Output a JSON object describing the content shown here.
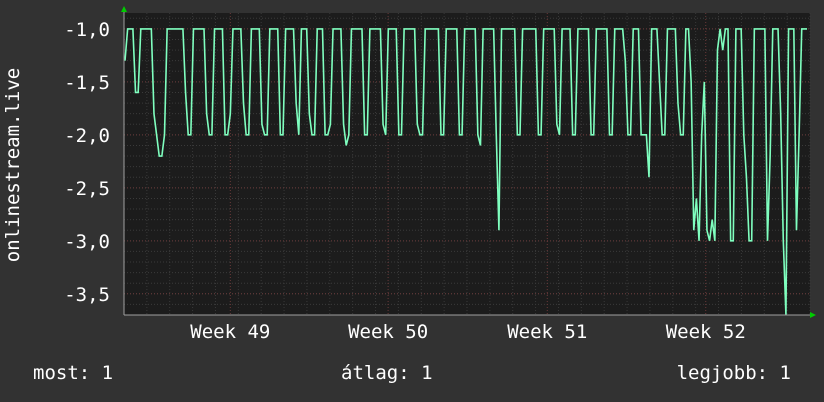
{
  "chart_data": {
    "type": "line",
    "ylabel": "onlinestream.live",
    "ylim": [
      -3.7,
      -0.85
    ],
    "yticks": [
      "-1,0",
      "-1,5",
      "-2,0",
      "-2,5",
      "-3,0",
      "-3,5"
    ],
    "ytick_values": [
      -1.0,
      -1.5,
      -2.0,
      -2.5,
      -3.0,
      -3.5
    ],
    "xticks": [
      "Week 49",
      "Week 50",
      "Week 51",
      "Week 52"
    ],
    "xtick_values": [
      0.155,
      0.385,
      0.617,
      0.848
    ],
    "xlim": [
      0,
      1
    ],
    "grid": true,
    "line_color": "#7fffbf",
    "grid_color": "#4a4a4a",
    "series": [
      {
        "values": [
          -1.3,
          -1.0,
          -1.0,
          -1.0,
          -1.6,
          -1.6,
          -1.0,
          -1.0,
          -1.0,
          -1.0,
          -1.0,
          -1.8,
          -2.0,
          -2.2,
          -2.2,
          -2.0,
          -1.0,
          -1.0,
          -1.0,
          -1.0,
          -1.0,
          -1.0,
          -1.0,
          -1.6,
          -2.0,
          -2.0,
          -1.0,
          -1.0,
          -1.0,
          -1.0,
          -1.0,
          -1.8,
          -2.0,
          -2.0,
          -1.0,
          -1.0,
          -1.0,
          -1.0,
          -2.0,
          -2.0,
          -1.8,
          -1.0,
          -1.0,
          -1.0,
          -1.0,
          -1.7,
          -2.0,
          -2.0,
          -1.0,
          -1.0,
          -1.0,
          -1.0,
          -1.9,
          -2.0,
          -2.0,
          -1.0,
          -1.0,
          -1.0,
          -1.0,
          -2.0,
          -2.0,
          -1.0,
          -1.0,
          -1.0,
          -1.0,
          -1.7,
          -2.0,
          -1.0,
          -1.0,
          -1.0,
          -1.8,
          -2.0,
          -2.0,
          -1.0,
          -1.0,
          -1.0,
          -2.0,
          -2.0,
          -1.9,
          -1.0,
          -1.0,
          -1.0,
          -1.0,
          -1.9,
          -2.1,
          -2.0,
          -1.0,
          -1.0,
          -1.0,
          -1.0,
          -1.0,
          -2.0,
          -2.0,
          -1.0,
          -1.0,
          -1.0,
          -1.0,
          -1.0,
          -1.9,
          -2.0,
          -1.0,
          -1.0,
          -1.0,
          -1.0,
          -2.0,
          -2.0,
          -1.0,
          -1.0,
          -1.0,
          -1.0,
          -1.0,
          -1.9,
          -2.0,
          -2.0,
          -1.0,
          -1.0,
          -1.0,
          -1.0,
          -1.0,
          -1.0,
          -2.0,
          -2.0,
          -1.0,
          -1.0,
          -1.0,
          -1.0,
          -1.0,
          -2.0,
          -2.0,
          -1.0,
          -1.0,
          -1.0,
          -1.0,
          -1.0,
          -2.0,
          -2.1,
          -1.0,
          -1.0,
          -1.0,
          -1.0,
          -1.0,
          -2.0,
          -2.9,
          -1.0,
          -1.0,
          -1.0,
          -1.0,
          -1.0,
          -1.0,
          -2.0,
          -2.0,
          -1.0,
          -1.0,
          -1.0,
          -1.0,
          -1.0,
          -1.0,
          -2.0,
          -2.0,
          -1.0,
          -1.0,
          -1.0,
          -1.0,
          -1.0,
          -1.9,
          -2.0,
          -1.0,
          -1.0,
          -1.0,
          -1.0,
          -2.0,
          -2.0,
          -1.0,
          -1.0,
          -1.0,
          -1.0,
          -1.0,
          -2.0,
          -2.0,
          -1.0,
          -1.0,
          -1.0,
          -1.0,
          -1.0,
          -2.0,
          -2.0,
          -1.0,
          -1.0,
          -1.0,
          -1.0,
          -1.3,
          -2.0,
          -2.0,
          -1.0,
          -1.0,
          -1.0,
          -2.0,
          -2.0,
          -2.0,
          -2.4,
          -1.0,
          -1.0,
          -1.0,
          -1.5,
          -2.0,
          -2.0,
          -1.0,
          -1.0,
          -1.0,
          -1.0,
          -1.7,
          -2.0,
          -2.0,
          -1.0,
          -1.0,
          -1.5,
          -2.9,
          -2.6,
          -3.0,
          -2.0,
          -1.5,
          -2.9,
          -3.0,
          -2.8,
          -3.0,
          -1.2,
          -1.0,
          -1.2,
          -1.0,
          -1.0,
          -3.0,
          -3.0,
          -1.0,
          -1.0,
          -1.0,
          -2.0,
          -2.4,
          -3.0,
          -3.0,
          -1.0,
          -1.0,
          -1.0,
          -1.0,
          -1.0,
          -3.0,
          -2.2,
          -1.0,
          -1.0,
          -1.0,
          -1.8,
          -3.0,
          -3.7,
          -1.0,
          -1.0,
          -1.0,
          -2.9,
          -2.0,
          -1.0,
          -1.0,
          -1.0
        ]
      }
    ]
  },
  "stats": {
    "now": "most: 1",
    "avg": "átlag: 1",
    "best": "legjobb: 1"
  }
}
